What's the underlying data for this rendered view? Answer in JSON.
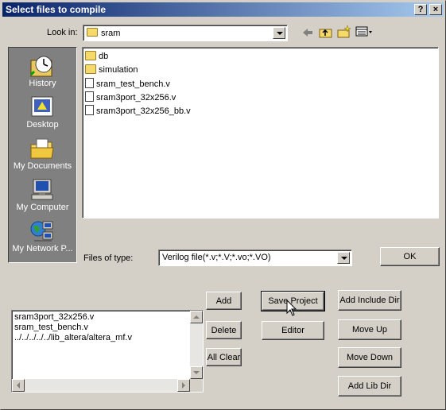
{
  "window": {
    "title": "Select files to compile",
    "help_label": "?",
    "close_label": "×"
  },
  "look_in": {
    "label": "Look in:",
    "value": "sram"
  },
  "places": [
    {
      "label": "History",
      "icon": "history-icon"
    },
    {
      "label": "Desktop",
      "icon": "desktop-icon"
    },
    {
      "label": "My Documents",
      "icon": "my-documents-icon"
    },
    {
      "label": "My Computer",
      "icon": "my-computer-icon"
    },
    {
      "label": "My Network P...",
      "icon": "my-network-places-icon"
    }
  ],
  "files": [
    {
      "name": "db",
      "type": "folder"
    },
    {
      "name": "simulation",
      "type": "folder"
    },
    {
      "name": "sram_test_bench.v",
      "type": "file"
    },
    {
      "name": "sram3port_32x256.v",
      "type": "file"
    },
    {
      "name": "sram3port_32x256_bb.v",
      "type": "file"
    }
  ],
  "files_of_type": {
    "label": "Files of type:",
    "value": "Verilog file(*.v;*.V;*.vo;*.VO)"
  },
  "buttons": {
    "ok": "OK",
    "add": "Add",
    "delete": "Delete",
    "all_clear": "All Clear",
    "save_project": "Save Project",
    "editor": "Editor",
    "add_include_dir": "Add Include Dir",
    "move_up": "Move Up",
    "move_down": "Move Down",
    "add_lib_dir": "Add Lib Dir"
  },
  "selected_files": [
    "sram3port_32x256.v",
    "sram_test_bench.v",
    "../../../../../lib_altera/altera_mf.v"
  ]
}
